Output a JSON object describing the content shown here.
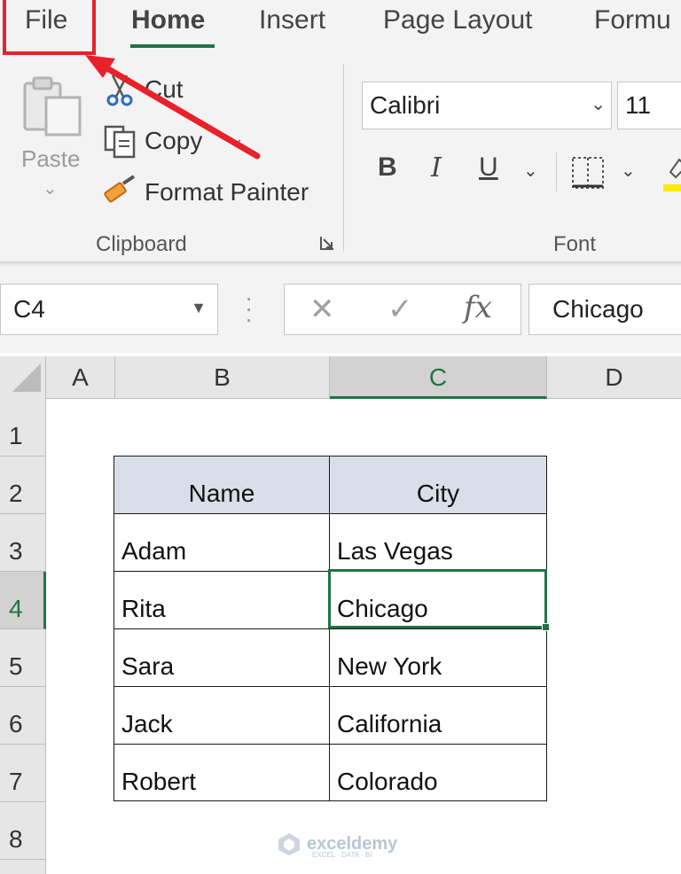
{
  "ribbon": {
    "tabs": [
      {
        "label": "File"
      },
      {
        "label": "Home"
      },
      {
        "label": "Insert"
      },
      {
        "label": "Page Layout"
      },
      {
        "label": "Formu"
      }
    ],
    "active_tab": "Home",
    "clipboard": {
      "paste_label": "Paste",
      "cut_label": "Cut",
      "copy_label": "Copy",
      "format_painter_label": "Format Painter",
      "group_label": "Clipboard"
    },
    "font": {
      "font_name": "Calibri",
      "font_size": "11",
      "bold_label": "B",
      "italic_label": "I",
      "underline_label": "U",
      "group_label": "Font"
    }
  },
  "formula_bar": {
    "name_box": "C4",
    "cancel_glyph": "✕",
    "enter_glyph": "✓",
    "fx_label": "fx",
    "content": "Chicago"
  },
  "sheet": {
    "columns": [
      "A",
      "B",
      "C",
      "D"
    ],
    "selected_column": "C",
    "rows": [
      "1",
      "2",
      "3",
      "4",
      "5",
      "6",
      "7",
      "8"
    ],
    "selected_row": "4",
    "table": {
      "headers": [
        "Name",
        "City"
      ],
      "rows": [
        [
          "Adam",
          "Las Vegas"
        ],
        [
          "Rita",
          "Chicago"
        ],
        [
          "Sara",
          "New York"
        ],
        [
          "Jack",
          "California"
        ],
        [
          "Robert",
          "Colorado"
        ]
      ]
    }
  },
  "colors": {
    "accent": "#217346",
    "annotation": "#e8212a",
    "table_header_bg": "#d9dfe8"
  },
  "watermark": {
    "name": "exceldemy",
    "tagline": "EXCEL · DATA · BI"
  }
}
